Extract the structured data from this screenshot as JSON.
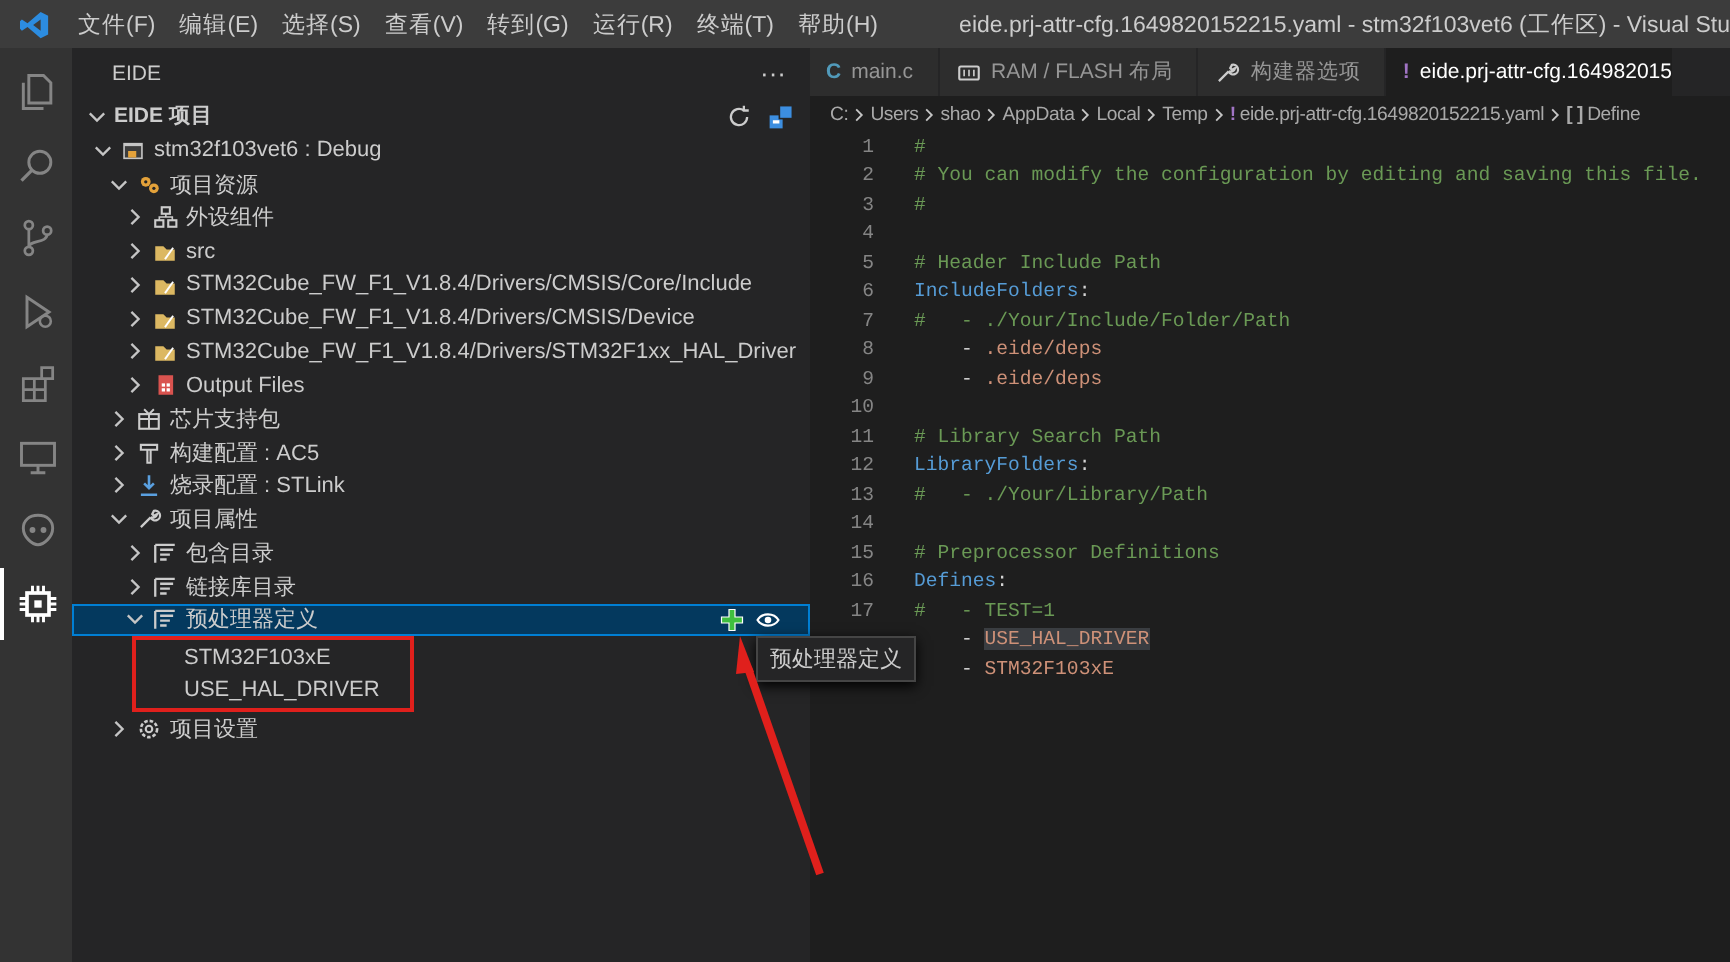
{
  "titlebar": {
    "menu": [
      "文件(F)",
      "编辑(E)",
      "选择(S)",
      "查看(V)",
      "转到(G)",
      "运行(R)",
      "终端(T)",
      "帮助(H)"
    ],
    "title": "eide.prj-attr-cfg.1649820152215.yaml - stm32f103vet6 (工作区) - Visual Stu"
  },
  "activity_bar": [
    {
      "selected": false
    },
    {
      "selected": false
    },
    {
      "selected": false
    },
    {
      "selected": false
    },
    {
      "selected": false
    },
    {
      "selected": false
    },
    {
      "selected": false
    },
    {
      "selected": true
    }
  ],
  "sidebar": {
    "title": "EIDE",
    "more": "···",
    "section": {
      "title": "EIDE 项目",
      "expanded": true
    },
    "tree": [
      {
        "label": "stm32f103vet6 : Debug",
        "kind": "project",
        "expanded": true,
        "selected": false,
        "children": [
          {
            "label": "项目资源",
            "kind": "resources",
            "expanded": true,
            "selected": false,
            "children": [
              {
                "label": "外设组件",
                "kind": "components",
                "expanded": false,
                "selected": false
              },
              {
                "label": "src",
                "kind": "folder",
                "expanded": false,
                "selected": false
              },
              {
                "label": "STM32Cube_FW_F1_V1.8.4/Drivers/CMSIS/Core/Include",
                "kind": "folder",
                "expanded": false,
                "selected": false
              },
              {
                "label": "STM32Cube_FW_F1_V1.8.4/Drivers/CMSIS/Device",
                "kind": "folder",
                "expanded": false,
                "selected": false
              },
              {
                "label": "STM32Cube_FW_F1_V1.8.4/Drivers/STM32F1xx_HAL_Driver",
                "kind": "folder",
                "expanded": false,
                "selected": false
              },
              {
                "label": "Output Files",
                "kind": "output",
                "expanded": false,
                "selected": false
              }
            ]
          },
          {
            "label": "芯片支持包",
            "kind": "package",
            "expanded": false,
            "selected": false
          },
          {
            "label": "构建配置 : AC5",
            "kind": "builder",
            "expanded": false,
            "selected": false
          },
          {
            "label": "烧录配置 : STLink",
            "kind": "flasher",
            "expanded": false,
            "selected": false
          },
          {
            "label": "项目属性",
            "kind": "properties",
            "expanded": true,
            "selected": false,
            "children": [
              {
                "label": "包含目录",
                "kind": "list",
                "expanded": false,
                "selected": false
              },
              {
                "label": "链接库目录",
                "kind": "list",
                "expanded": false,
                "selected": false
              },
              {
                "label": "预处理器定义",
                "kind": "list",
                "expanded": true,
                "selected": true,
                "outlined_children": true,
                "children": [
                  {
                    "label": "STM32F103xE",
                    "selected": false
                  },
                  {
                    "label": "USE_HAL_DRIVER",
                    "selected": false
                  }
                ]
              }
            ]
          },
          {
            "label": "项目设置",
            "kind": "settings",
            "expanded": false,
            "selected": false
          }
        ]
      }
    ]
  },
  "tooltip": {
    "text": "预处理器定义"
  },
  "annotation_arrow": true,
  "editor": {
    "tabs": [
      {
        "label": "main.c",
        "glyph": "C",
        "selected": false
      },
      {
        "label": "RAM / FLASH 布局",
        "selected": false
      },
      {
        "label": "构建器选项",
        "selected": false
      },
      {
        "label": "eide.prj-attr-cfg.164982015",
        "glyph": "!",
        "selected": true
      }
    ],
    "breadcrumb": [
      {
        "label": "C:"
      },
      {
        "label": "Users"
      },
      {
        "label": "shao"
      },
      {
        "label": "AppData"
      },
      {
        "label": "Local"
      },
      {
        "label": "Temp"
      },
      {
        "label": "eide.prj-attr-cfg.1649820152215.yaml",
        "glyph": "!"
      },
      {
        "label": "Define",
        "glyph": "[ ]"
      }
    ],
    "lines": [
      {
        "number": "1",
        "tokens": [
          {
            "kind": "comment",
            "text": "#"
          }
        ]
      },
      {
        "number": "2",
        "tokens": [
          {
            "kind": "comment",
            "text": "# You can modify the configuration by editing and saving this file."
          }
        ]
      },
      {
        "number": "3",
        "tokens": [
          {
            "kind": "comment",
            "text": "#"
          }
        ]
      },
      {
        "number": "4"
      },
      {
        "number": "5",
        "tokens": [
          {
            "kind": "comment",
            "text": "# Header Include Path"
          }
        ]
      },
      {
        "number": "6",
        "tokens": [
          {
            "kind": "key",
            "text": "IncludeFolders"
          },
          {
            "kind": "plain",
            "text": ":"
          }
        ]
      },
      {
        "number": "7",
        "tokens": [
          {
            "kind": "comment",
            "text": "#   - ./Your/Include/Folder/Path"
          }
        ]
      },
      {
        "number": "8",
        "tokens": [
          {
            "kind": "plain",
            "text": "    - "
          },
          {
            "kind": "string",
            "text": ".eide/deps"
          }
        ]
      },
      {
        "number": "9",
        "tokens": [
          {
            "kind": "plain",
            "text": "    - "
          },
          {
            "kind": "string",
            "text": ".eide/deps"
          }
        ]
      },
      {
        "number": "10"
      },
      {
        "number": "11",
        "tokens": [
          {
            "kind": "comment",
            "text": "# Library Search Path"
          }
        ]
      },
      {
        "number": "12",
        "tokens": [
          {
            "kind": "key",
            "text": "LibraryFolders"
          },
          {
            "kind": "plain",
            "text": ":"
          }
        ]
      },
      {
        "number": "13",
        "tokens": [
          {
            "kind": "comment",
            "text": "#   - ./Your/Library/Path"
          }
        ]
      },
      {
        "number": "14"
      },
      {
        "number": "15",
        "tokens": [
          {
            "kind": "comment",
            "text": "# Preprocessor Definitions"
          }
        ]
      },
      {
        "number": "16",
        "tokens": [
          {
            "kind": "key",
            "text": "Defines"
          },
          {
            "kind": "plain",
            "text": ":"
          }
        ]
      },
      {
        "number": "17",
        "tokens": [
          {
            "kind": "comment",
            "text": "#   - TEST=1"
          }
        ]
      },
      {
        "tokens": [
          {
            "kind": "plain",
            "text": "    - "
          },
          {
            "kind": "string",
            "text": "USE_HAL_DRIVER",
            "highlighted": true
          }
        ]
      },
      {
        "tokens": [
          {
            "kind": "plain",
            "text": "    - "
          },
          {
            "kind": "string",
            "text": "STM32F103xE"
          }
        ]
      }
    ]
  }
}
